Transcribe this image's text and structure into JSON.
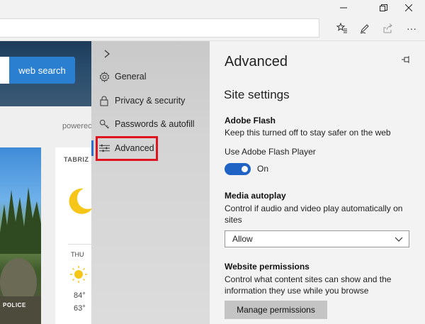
{
  "window_controls": {
    "minimize_icon": "minimize-icon",
    "restore_icon": "restore-icon",
    "close_icon": "close-icon"
  },
  "toolbar": {
    "icons": [
      "favorites-icon",
      "pen-icon",
      "share-icon",
      "more-icon"
    ],
    "more_label": "···"
  },
  "webpage": {
    "search_button": "web search",
    "powered_text": "powerec",
    "weather_city": "TABRIZ",
    "weather_day": "THU",
    "temp_high": "84°",
    "temp_low": "63°",
    "photo_caption": "POLICE"
  },
  "hub": {
    "collapse_label": ">",
    "items": [
      {
        "label": "General",
        "icon": "gear-icon"
      },
      {
        "label": "Privacy & security",
        "icon": "lock-icon"
      },
      {
        "label": "Passwords & autofill",
        "icon": "key-icon"
      },
      {
        "label": "Advanced",
        "icon": "sliders-icon",
        "active": true
      }
    ]
  },
  "panel": {
    "title": "Advanced",
    "pin_icon": "pin-icon",
    "section_title": "Site settings",
    "flash": {
      "heading": "Adobe Flash",
      "description": "Keep this turned off to stay safer on the web",
      "toggle_label": "Use Adobe Flash Player",
      "toggle_state": "On"
    },
    "autoplay": {
      "heading": "Media autoplay",
      "description": "Control if audio and video play automatically on sites",
      "selected": "Allow"
    },
    "permissions": {
      "heading": "Website permissions",
      "description": "Control what content sites can show and the information they use while you browse",
      "button_label": "Manage permissions"
    }
  },
  "colors": {
    "accent": "#1f63c5",
    "highlight_box": "#e0141e",
    "search_button": "#2b7fd0"
  }
}
